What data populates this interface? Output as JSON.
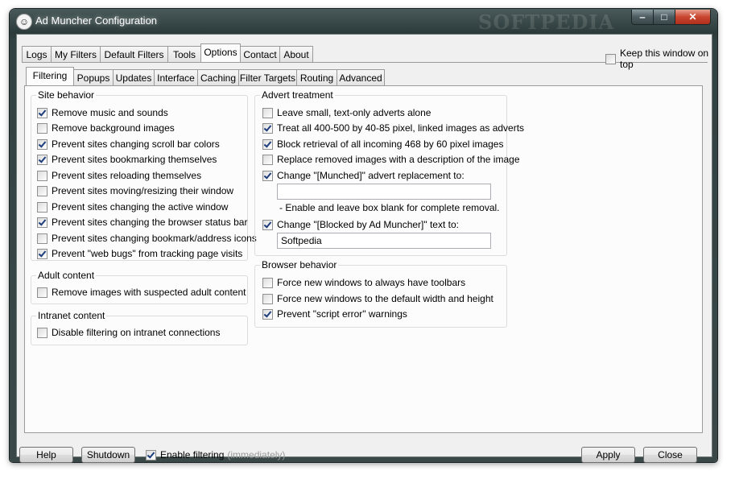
{
  "window": {
    "title": "Ad Muncher Configuration",
    "watermark": "SOFTPEDIA",
    "controls": {
      "minimize": "‒",
      "maximize": "□",
      "close": "✕"
    }
  },
  "top_tabs": [
    "Logs",
    "My Filters",
    "Default Filters",
    "Tools",
    "Options",
    "Contact",
    "About"
  ],
  "top_tab_active": "Options",
  "keep_on_top": {
    "label": "Keep this window on top",
    "checked": false
  },
  "sub_tabs": [
    "Filtering",
    "Popups",
    "Updates",
    "Interface",
    "Caching",
    "Filter Targets",
    "Routing",
    "Advanced"
  ],
  "sub_tab_active": "Filtering",
  "site_behavior": {
    "title": "Site behavior",
    "items": [
      {
        "label": "Remove music and sounds",
        "checked": true
      },
      {
        "label": "Remove background images",
        "checked": false
      },
      {
        "label": "Prevent sites changing scroll bar colors",
        "checked": true
      },
      {
        "label": "Prevent sites bookmarking themselves",
        "checked": true
      },
      {
        "label": "Prevent sites reloading themselves",
        "checked": false
      },
      {
        "label": "Prevent sites moving/resizing their window",
        "checked": false
      },
      {
        "label": "Prevent sites changing the active window",
        "checked": false
      },
      {
        "label": "Prevent sites changing the browser status bar",
        "checked": true
      },
      {
        "label": "Prevent sites changing bookmark/address icons",
        "checked": false
      },
      {
        "label": "Prevent \"web bugs\" from tracking page visits",
        "checked": true
      }
    ]
  },
  "adult_content": {
    "title": "Adult content",
    "items": [
      {
        "label": "Remove images with suspected adult content",
        "checked": false
      }
    ]
  },
  "intranet_content": {
    "title": "Intranet content",
    "items": [
      {
        "label": "Disable filtering on intranet connections",
        "checked": false
      }
    ]
  },
  "advert_treatment": {
    "title": "Advert treatment",
    "items": [
      {
        "label": "Leave small, text-only adverts alone",
        "checked": false
      },
      {
        "label": "Treat all 400-500 by 40-85 pixel, linked images as adverts",
        "checked": true
      },
      {
        "label": "Block retrieval of all incoming 468 by 60 pixel images",
        "checked": true
      },
      {
        "label": "Replace removed images with a description of the image",
        "checked": false
      },
      {
        "label": "Change \"[Munched]\" advert replacement to:",
        "checked": true
      }
    ],
    "munched_value": "",
    "hint": "- Enable and leave box blank for complete removal.",
    "blocked": {
      "label": "Change \"[Blocked by Ad Muncher]\" text to:",
      "checked": true
    },
    "blocked_value": "Softpedia"
  },
  "browser_behavior": {
    "title": "Browser behavior",
    "items": [
      {
        "label": "Force new windows to always have toolbars",
        "checked": false
      },
      {
        "label": "Force new windows to the default width and height",
        "checked": false
      },
      {
        "label": "Prevent \"script error\" warnings",
        "checked": true
      }
    ]
  },
  "footer": {
    "help": "Help",
    "shutdown": "Shutdown",
    "enable_filtering": {
      "label": "Enable filtering",
      "checked": true
    },
    "immediately": "(immediately)",
    "apply": "Apply",
    "close": "Close"
  }
}
